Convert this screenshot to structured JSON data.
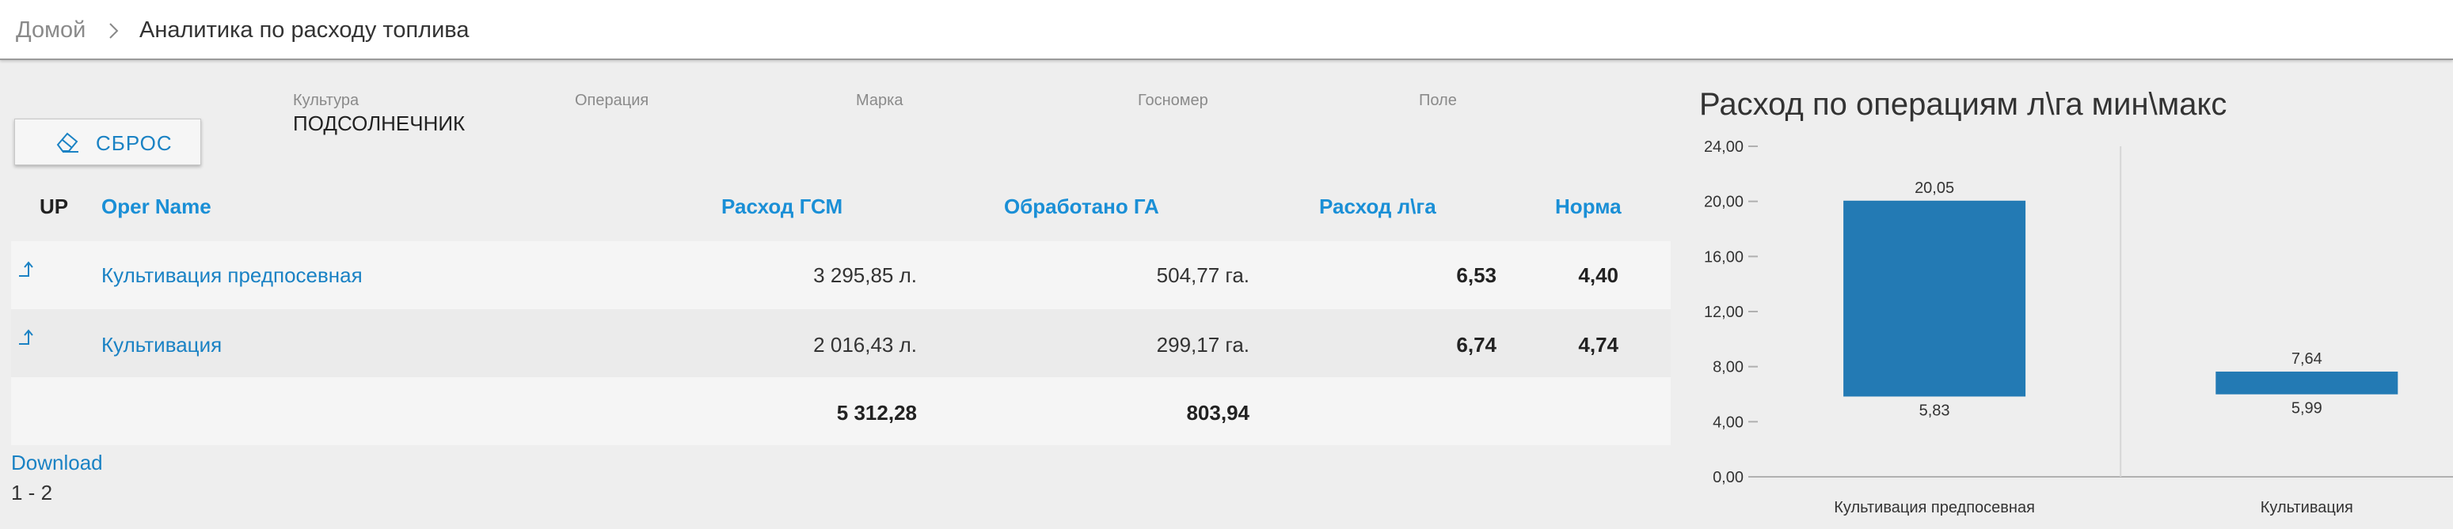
{
  "breadcrumb": {
    "home": "Домой",
    "separator": "›",
    "current": "Аналитика по расходу топлива"
  },
  "filters": [
    {
      "label": "Культура",
      "value": "ПОДСОЛНЕЧНИК"
    },
    {
      "label": "Операция",
      "value": ""
    },
    {
      "label": "Марка",
      "value": ""
    },
    {
      "label": "Госномер",
      "value": ""
    },
    {
      "label": "Поле",
      "value": ""
    }
  ],
  "reset_button": {
    "label": "СБРОС",
    "icon": "eraser-icon"
  },
  "table": {
    "headers": {
      "up": "UP",
      "oper_name": "Oper Name",
      "fuel": "Расход ГСМ",
      "area": "Обработано ГА",
      "rate": "Расход л\\га",
      "norm": "Норма"
    },
    "rows": [
      {
        "oper_name": "Культивация предпосевная",
        "fuel": "3 295,85 л.",
        "area": "504,77 га.",
        "rate": "6,53",
        "norm": "4,40"
      },
      {
        "oper_name": "Культивация",
        "fuel": "2 016,43 л.",
        "area": "299,17 га.",
        "rate": "6,74",
        "norm": "4,74"
      }
    ],
    "totals": {
      "fuel": "5 312,28",
      "area": "803,94"
    }
  },
  "download_label": "Download",
  "pager_label": "1 - 2",
  "colors": {
    "accent": "#1a82c4",
    "bar": "#237ab4"
  },
  "chart_data": {
    "type": "bar",
    "title": "Расход по операциям л\\га мин\\макс",
    "categories": [
      "Культивация предпосевная",
      "Культивация"
    ],
    "series": [
      {
        "name": "min",
        "values": [
          5.83,
          5.99
        ]
      },
      {
        "name": "max",
        "values": [
          20.05,
          7.64
        ]
      }
    ],
    "data_labels": [
      {
        "min": "5,83",
        "max": "20,05"
      },
      {
        "min": "5,99",
        "max": "7,64"
      }
    ],
    "yticks": [
      "0,00",
      "4,00",
      "8,00",
      "12,00",
      "16,00",
      "20,00",
      "24,00"
    ],
    "ylim": [
      0,
      24
    ],
    "grid": true,
    "legend": "none"
  }
}
